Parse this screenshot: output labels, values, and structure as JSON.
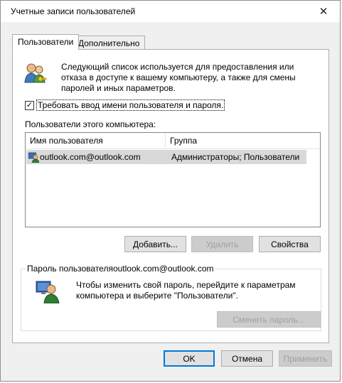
{
  "window": {
    "title": "Учетные записи пользователей",
    "close_glyph": "✕"
  },
  "tabs": [
    {
      "label": "Пользователи",
      "active": true
    },
    {
      "label": "Дополнительно",
      "active": false
    }
  ],
  "users_tab": {
    "description": "Следующий список используется для предоставления или отказа в доступе к вашему компьютеру, а также для смены паролей и иных параметров.",
    "require_login_label": "Требовать ввод имени пользователя и пароля.",
    "require_login_checked": true,
    "check_glyph": "✓",
    "users_list_label": "Пользователи этого компьютера:",
    "columns": [
      "Имя пользователя",
      "Группа"
    ],
    "rows": [
      {
        "name": "outlook.com@outlook.com",
        "group": "Администраторы; Пользователи",
        "icon": "user-account-icon"
      }
    ],
    "buttons": {
      "add": "Добавить...",
      "remove": "Удалить",
      "properties": "Свойства"
    },
    "password_group": {
      "legend": "Пароль пользователяoutlook.com@outlook.com",
      "text": "Чтобы изменить свой пароль, перейдите к параметрам компьютера и выберите \"Пользователи\".",
      "change_button": "Сменить пароль..."
    }
  },
  "footer": {
    "ok": "OK",
    "cancel": "Отмена",
    "apply": "Применить"
  },
  "colors": {
    "accent": "#0078d7",
    "selection": "#d9d9d9",
    "window_bg": "#f0f0f0"
  }
}
